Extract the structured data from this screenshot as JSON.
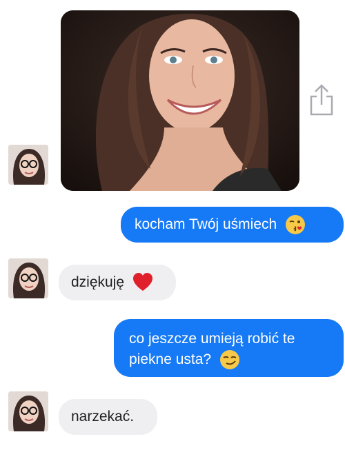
{
  "conversation": {
    "shared_photo": {
      "icon": "share-icon"
    },
    "messages": [
      {
        "direction": "outgoing",
        "text": "kocham Twój uśmiech",
        "emoji": "kissing-face-emoji"
      },
      {
        "direction": "incoming",
        "text": "dziękuję",
        "emoji": "red-heart-emoji"
      },
      {
        "direction": "outgoing",
        "lines": [
          "co jeszcze umieją robić te",
          "piekne usta?"
        ],
        "emoji": "smirking-face-emoji"
      },
      {
        "direction": "incoming",
        "text": "narzekać."
      }
    ]
  },
  "colors": {
    "outgoing_bubble": "#1679f5",
    "incoming_bubble": "#efeff2",
    "background": "#ffffff"
  }
}
